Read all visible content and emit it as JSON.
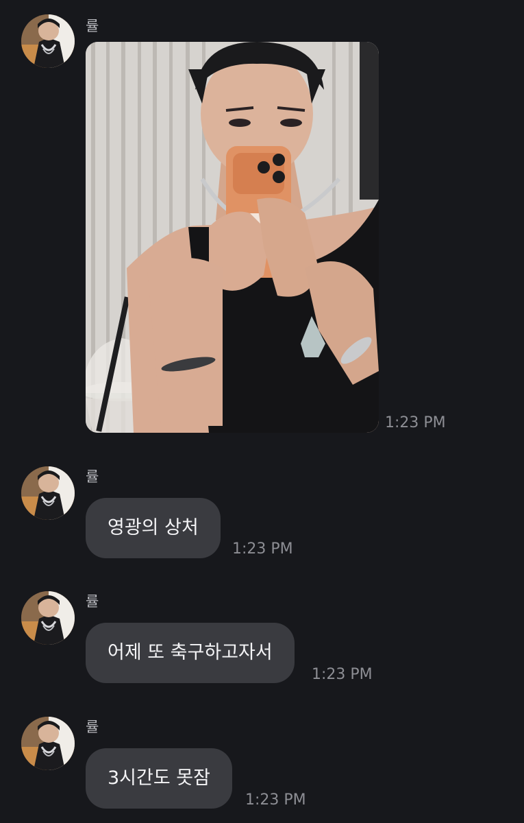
{
  "chat": {
    "messages": [
      {
        "sender": "률",
        "type": "image",
        "image_alt": "mirror selfie photo",
        "time": "1:23 PM"
      },
      {
        "sender": "률",
        "type": "text",
        "text": "영광의 상처",
        "time": "1:23 PM"
      },
      {
        "sender": "률",
        "type": "text",
        "text": "어제 또 축구하고자서",
        "time": "1:23 PM"
      },
      {
        "sender": "률",
        "type": "text",
        "text": "3시간도 못잠",
        "time": "1:23 PM"
      }
    ]
  },
  "colors": {
    "background": "#17181c",
    "bubble": "#3a3b40",
    "sender_name": "#b8b9be",
    "timestamp": "#8d8e94"
  },
  "icons": {
    "avatar": "profile-avatar"
  }
}
